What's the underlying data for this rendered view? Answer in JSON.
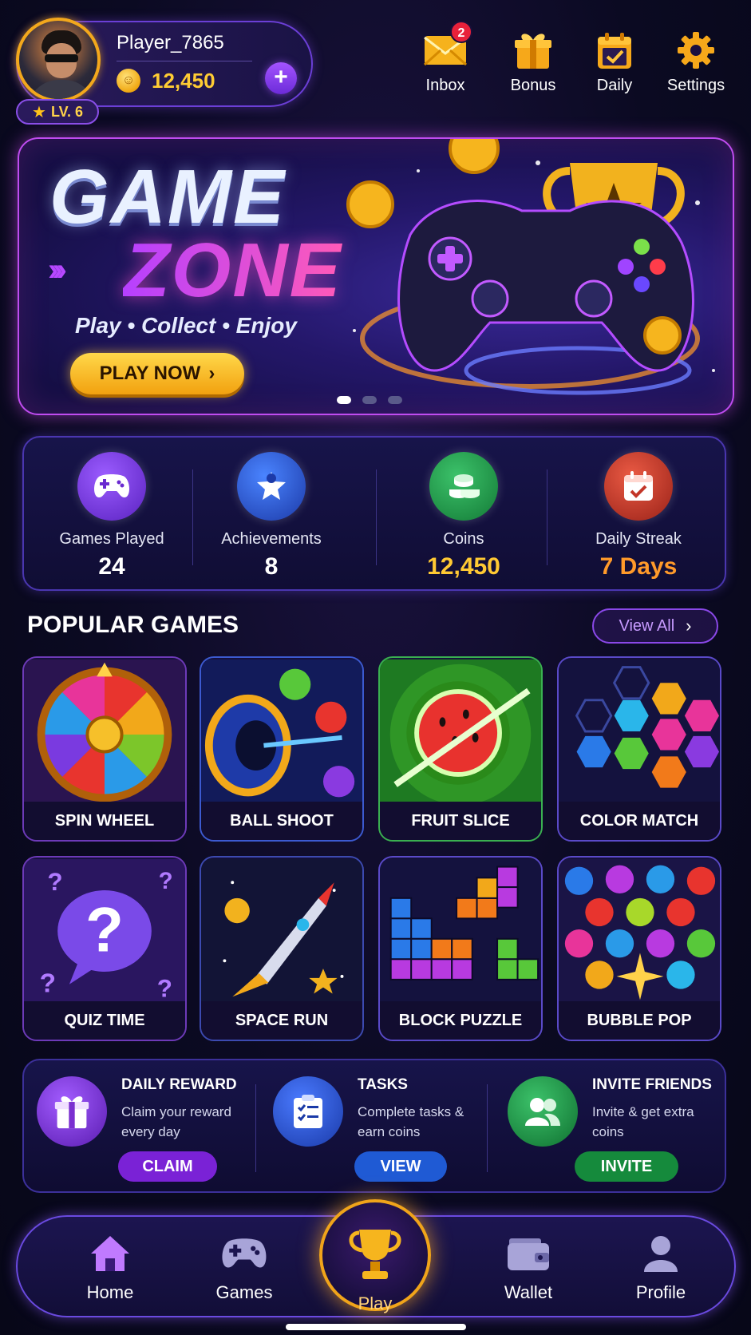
{
  "header": {
    "player_name": "Player_7865",
    "coin_balance": "12,450",
    "level": "LV. 6",
    "actions": [
      {
        "label": "Inbox",
        "icon": "envelope-icon",
        "badge": "2"
      },
      {
        "label": "Bonus",
        "icon": "gift-icon"
      },
      {
        "label": "Daily",
        "icon": "calendar-check-icon"
      },
      {
        "label": "Settings",
        "icon": "gear-icon"
      }
    ]
  },
  "banner": {
    "title_line1": "GAME",
    "title_line2": "ZONE",
    "tagline": "Play • Collect • Enjoy",
    "cta_label": "PLAY NOW",
    "page_count": 3,
    "active_page": 1
  },
  "stats": [
    {
      "label": "Games Played",
      "value": "24",
      "icon": "gamepad-icon",
      "color": "#7b3fe0",
      "value_color": "#ffffff"
    },
    {
      "label": "Achievements",
      "value": "8",
      "icon": "star-badge-icon",
      "color": "#2f5fd8",
      "value_color": "#ffffff"
    },
    {
      "label": "Coins",
      "value": "12,450",
      "icon": "coin-stack-icon",
      "color": "#1f9a4c",
      "value_color": "#ffc933"
    },
    {
      "label": "Daily Streak",
      "value": "7 Days",
      "icon": "calendar-icon",
      "color": "#c33628",
      "value_color": "#ff9a2a"
    }
  ],
  "popular": {
    "title": "POPULAR GAMES",
    "view_all_label": "View All",
    "games": [
      {
        "title": "SPIN WHEEL",
        "icon": "spin-wheel-icon"
      },
      {
        "title": "BALL SHOOT",
        "icon": "ball-cannon-icon"
      },
      {
        "title": "FRUIT SLICE",
        "icon": "watermelon-icon"
      },
      {
        "title": "COLOR MATCH",
        "icon": "hexagon-grid-icon"
      },
      {
        "title": "QUIZ TIME",
        "icon": "question-bubble-icon"
      },
      {
        "title": "SPACE RUN",
        "icon": "rocket-icon"
      },
      {
        "title": "BLOCK PUZZLE",
        "icon": "blocks-icon"
      },
      {
        "title": "BUBBLE POP",
        "icon": "bubbles-icon"
      }
    ]
  },
  "rewards": [
    {
      "title": "DAILY REWARD",
      "desc": "Claim your reward every day",
      "button": "CLAIM",
      "icon": "gift-icon",
      "color": "#7a2fd0",
      "button_color": "#7a22d6"
    },
    {
      "title": "TASKS",
      "desc": "Complete tasks & earn coins",
      "button": "VIEW",
      "icon": "clipboard-check-icon",
      "color": "#2850c8",
      "button_color": "#1f5ad4"
    },
    {
      "title": "INVITE FRIENDS",
      "desc": "Invite & get extra coins",
      "button": "INVITE",
      "icon": "users-icon",
      "color": "#1a8a44",
      "button_color": "#158a3c"
    }
  ],
  "nav": {
    "items": [
      {
        "label": "Home",
        "icon": "home-icon"
      },
      {
        "label": "Games",
        "icon": "gamepad-icon"
      },
      {
        "label": "Play",
        "icon": "trophy-icon"
      },
      {
        "label": "Wallet",
        "icon": "wallet-icon"
      },
      {
        "label": "Profile",
        "icon": "user-icon"
      }
    ]
  }
}
